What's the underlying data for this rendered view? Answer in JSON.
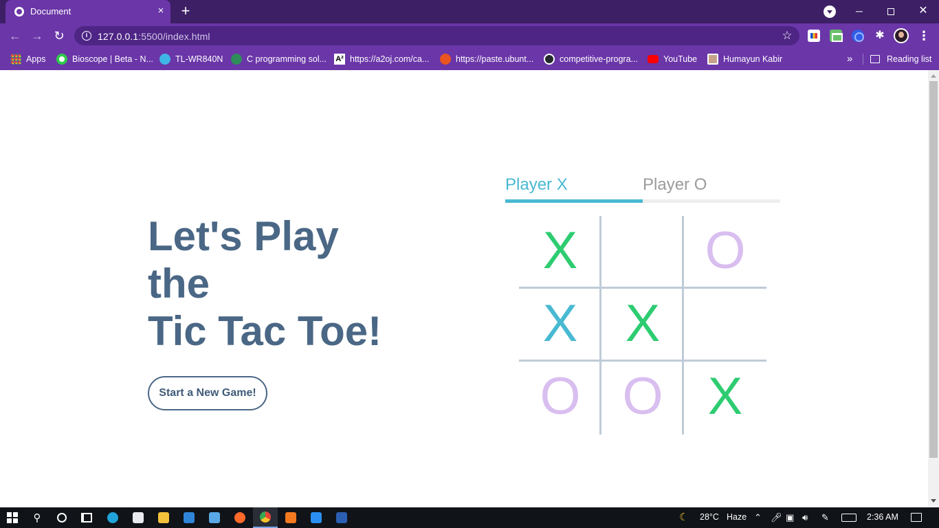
{
  "browser": {
    "tab_title": "Document",
    "tab_close": "×",
    "new_tab": "+",
    "url_host": "127.0.0.1",
    "url_path": ":5500/index.html",
    "window_minimize": "─",
    "window_close": "✕",
    "reading_list": "Reading list",
    "bookmarks_overflow": "»"
  },
  "bookmarks": [
    {
      "label": "Apps",
      "icon": "apps-grid-icon"
    },
    {
      "label": "Bioscope | Beta - N...",
      "icon": "bioscope-icon"
    },
    {
      "label": "TL-WR840N",
      "icon": "tplink-icon"
    },
    {
      "label": "C programming sol...",
      "icon": "cprogramming-icon"
    },
    {
      "label": "https://a2oj.com/ca...",
      "icon": "a2oj-icon",
      "icon_text": "A²"
    },
    {
      "label": "https://paste.ubunt...",
      "icon": "ubuntu-icon"
    },
    {
      "label": "competitive-progra...",
      "icon": "github-icon"
    },
    {
      "label": "YouTube",
      "icon": "youtube-icon"
    },
    {
      "label": "Humayun Kabir",
      "icon": "person-icon"
    }
  ],
  "page": {
    "heading_lines": [
      "Let's Play",
      "the",
      "Tic Tac Toe!"
    ],
    "new_game_button": "Start a New Game!",
    "players": {
      "x_label": "Player X",
      "o_label": "Player O",
      "active": "X"
    },
    "board": [
      [
        "X",
        "",
        "O"
      ],
      [
        "X",
        "X",
        ""
      ],
      [
        "O",
        "O",
        "X"
      ]
    ],
    "colors": {
      "x": "#2ecc71",
      "x_highlight": "#48b9d2",
      "o": "#d9bef0",
      "heading": "#4a6785",
      "active_player": "#48b9d2",
      "inactive_player": "#9b9b9b"
    },
    "highlighted_x_cell": "row 2, column 1"
  },
  "taskbar": {
    "weather_temp": "28°C",
    "weather_condition": "Haze",
    "clock": "2:36 AM"
  }
}
